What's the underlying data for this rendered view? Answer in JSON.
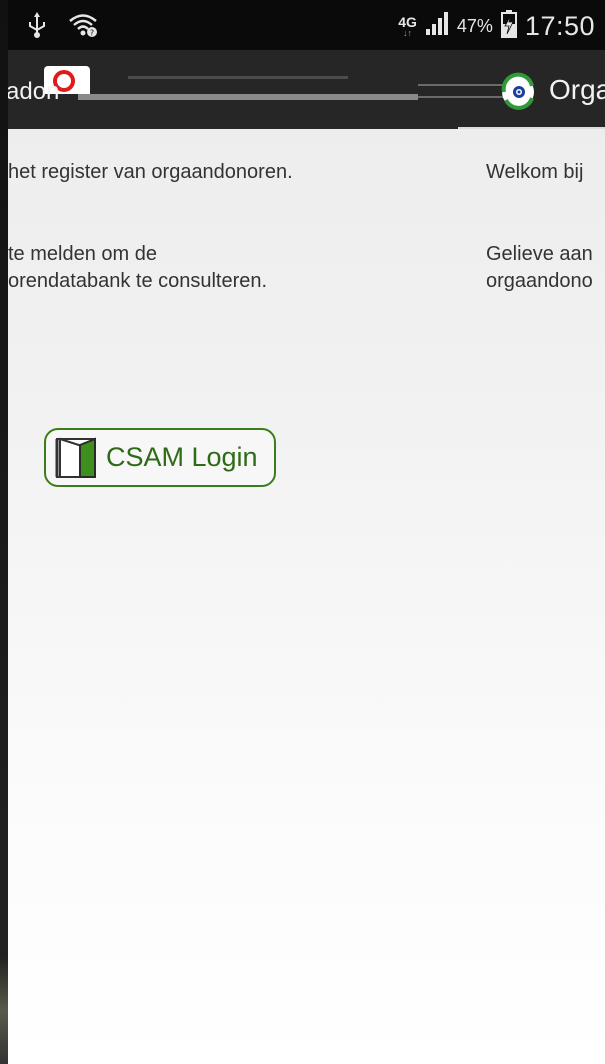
{
  "status_bar": {
    "network_type": "4G",
    "network_sub": "↓↑",
    "battery_percent": "47%",
    "time": "17:50",
    "icons": [
      "usb-icon",
      "wifi-icon",
      "signal-icon",
      "battery-charging-icon"
    ]
  },
  "header": {
    "left_title": "adon",
    "right_title": "Orga"
  },
  "pages": {
    "left": {
      "line1": "het register van orgaandonoren.",
      "line2": "te melden om de\norendatabank te consulteren."
    },
    "right": {
      "line1": "Welkom bij",
      "line2": "Gelieve aan\norgaandono"
    }
  },
  "login_button": {
    "label": "CSAM Login",
    "icon": "door-icon",
    "color": "#2e6b17"
  }
}
